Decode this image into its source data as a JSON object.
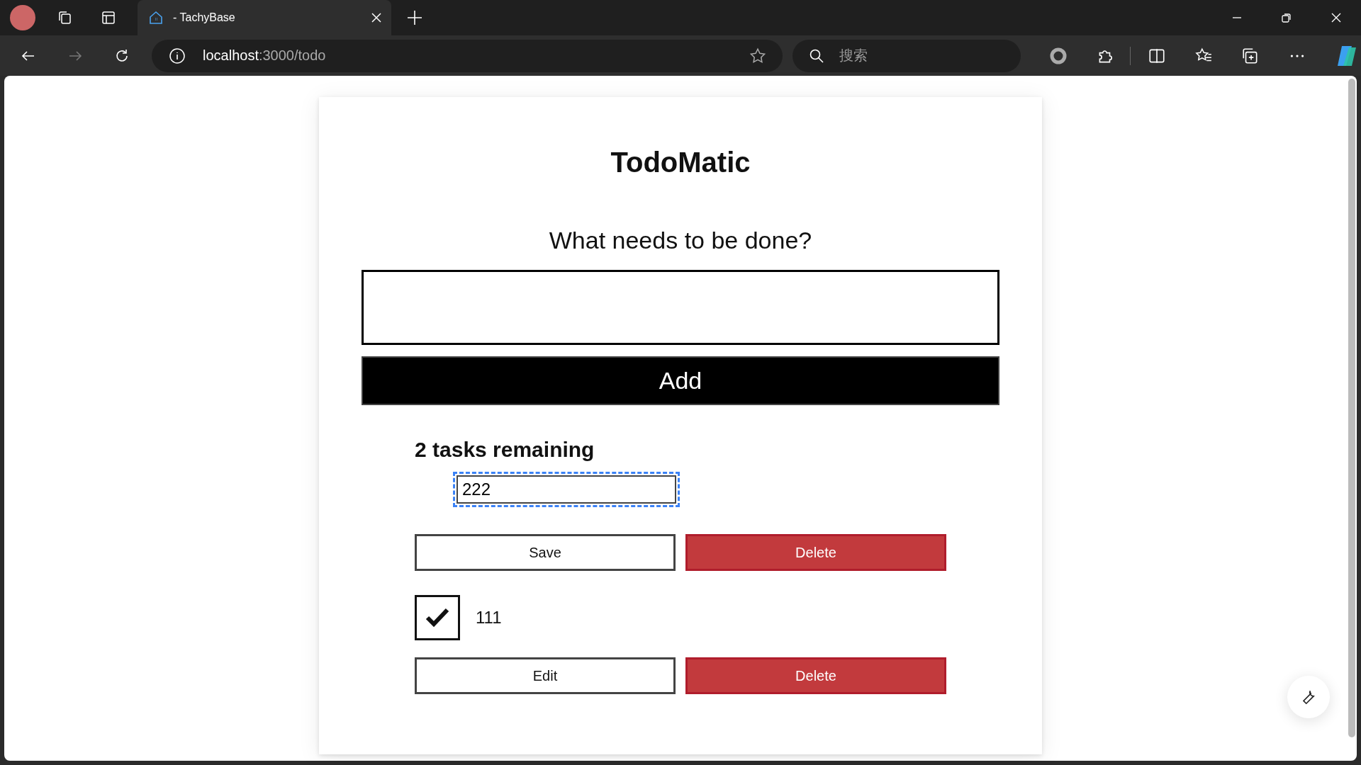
{
  "browser": {
    "tabs": [
      {
        "title": "- TachyBase",
        "selected": true
      }
    ],
    "address": {
      "host": "localhost",
      "path": ":3000/todo"
    },
    "search": {
      "placeholder": "搜索"
    }
  },
  "app": {
    "title": "TodoMatic",
    "prompt": "What needs to be done?",
    "add_button": "Add",
    "remaining": "2 tasks remaining",
    "tasks": [
      {
        "kind": "editing",
        "value": "222",
        "focused": true,
        "buttons": [
          "Save",
          "Delete"
        ]
      },
      {
        "kind": "view",
        "label": "111",
        "checked": true,
        "buttons": [
          "Edit",
          "Delete"
        ]
      }
    ]
  }
}
